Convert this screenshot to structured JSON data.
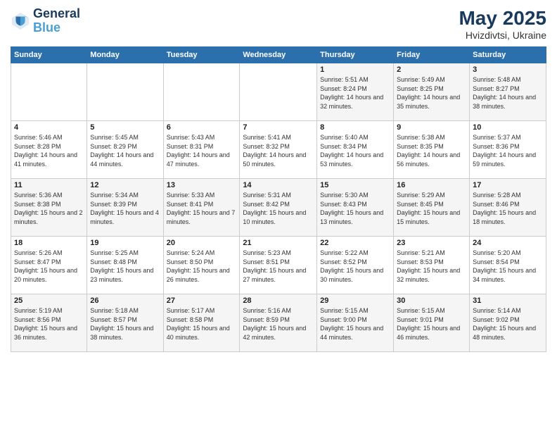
{
  "header": {
    "logo_line1": "General",
    "logo_line2": "Blue",
    "main_title": "May 2025",
    "subtitle": "Hvizdivtsi, Ukraine"
  },
  "calendar": {
    "days_of_week": [
      "Sunday",
      "Monday",
      "Tuesday",
      "Wednesday",
      "Thursday",
      "Friday",
      "Saturday"
    ],
    "weeks": [
      [
        {
          "day": "",
          "sunrise": "",
          "sunset": "",
          "daylight": ""
        },
        {
          "day": "",
          "sunrise": "",
          "sunset": "",
          "daylight": ""
        },
        {
          "day": "",
          "sunrise": "",
          "sunset": "",
          "daylight": ""
        },
        {
          "day": "",
          "sunrise": "",
          "sunset": "",
          "daylight": ""
        },
        {
          "day": "1",
          "sunrise": "Sunrise: 5:51 AM",
          "sunset": "Sunset: 8:24 PM",
          "daylight": "Daylight: 14 hours and 32 minutes."
        },
        {
          "day": "2",
          "sunrise": "Sunrise: 5:49 AM",
          "sunset": "Sunset: 8:25 PM",
          "daylight": "Daylight: 14 hours and 35 minutes."
        },
        {
          "day": "3",
          "sunrise": "Sunrise: 5:48 AM",
          "sunset": "Sunset: 8:27 PM",
          "daylight": "Daylight: 14 hours and 38 minutes."
        }
      ],
      [
        {
          "day": "4",
          "sunrise": "Sunrise: 5:46 AM",
          "sunset": "Sunset: 8:28 PM",
          "daylight": "Daylight: 14 hours and 41 minutes."
        },
        {
          "day": "5",
          "sunrise": "Sunrise: 5:45 AM",
          "sunset": "Sunset: 8:29 PM",
          "daylight": "Daylight: 14 hours and 44 minutes."
        },
        {
          "day": "6",
          "sunrise": "Sunrise: 5:43 AM",
          "sunset": "Sunset: 8:31 PM",
          "daylight": "Daylight: 14 hours and 47 minutes."
        },
        {
          "day": "7",
          "sunrise": "Sunrise: 5:41 AM",
          "sunset": "Sunset: 8:32 PM",
          "daylight": "Daylight: 14 hours and 50 minutes."
        },
        {
          "day": "8",
          "sunrise": "Sunrise: 5:40 AM",
          "sunset": "Sunset: 8:34 PM",
          "daylight": "Daylight: 14 hours and 53 minutes."
        },
        {
          "day": "9",
          "sunrise": "Sunrise: 5:38 AM",
          "sunset": "Sunset: 8:35 PM",
          "daylight": "Daylight: 14 hours and 56 minutes."
        },
        {
          "day": "10",
          "sunrise": "Sunrise: 5:37 AM",
          "sunset": "Sunset: 8:36 PM",
          "daylight": "Daylight: 14 hours and 59 minutes."
        }
      ],
      [
        {
          "day": "11",
          "sunrise": "Sunrise: 5:36 AM",
          "sunset": "Sunset: 8:38 PM",
          "daylight": "Daylight: 15 hours and 2 minutes."
        },
        {
          "day": "12",
          "sunrise": "Sunrise: 5:34 AM",
          "sunset": "Sunset: 8:39 PM",
          "daylight": "Daylight: 15 hours and 4 minutes."
        },
        {
          "day": "13",
          "sunrise": "Sunrise: 5:33 AM",
          "sunset": "Sunset: 8:41 PM",
          "daylight": "Daylight: 15 hours and 7 minutes."
        },
        {
          "day": "14",
          "sunrise": "Sunrise: 5:31 AM",
          "sunset": "Sunset: 8:42 PM",
          "daylight": "Daylight: 15 hours and 10 minutes."
        },
        {
          "day": "15",
          "sunrise": "Sunrise: 5:30 AM",
          "sunset": "Sunset: 8:43 PM",
          "daylight": "Daylight: 15 hours and 13 minutes."
        },
        {
          "day": "16",
          "sunrise": "Sunrise: 5:29 AM",
          "sunset": "Sunset: 8:45 PM",
          "daylight": "Daylight: 15 hours and 15 minutes."
        },
        {
          "day": "17",
          "sunrise": "Sunrise: 5:28 AM",
          "sunset": "Sunset: 8:46 PM",
          "daylight": "Daylight: 15 hours and 18 minutes."
        }
      ],
      [
        {
          "day": "18",
          "sunrise": "Sunrise: 5:26 AM",
          "sunset": "Sunset: 8:47 PM",
          "daylight": "Daylight: 15 hours and 20 minutes."
        },
        {
          "day": "19",
          "sunrise": "Sunrise: 5:25 AM",
          "sunset": "Sunset: 8:48 PM",
          "daylight": "Daylight: 15 hours and 23 minutes."
        },
        {
          "day": "20",
          "sunrise": "Sunrise: 5:24 AM",
          "sunset": "Sunset: 8:50 PM",
          "daylight": "Daylight: 15 hours and 26 minutes."
        },
        {
          "day": "21",
          "sunrise": "Sunrise: 5:23 AM",
          "sunset": "Sunset: 8:51 PM",
          "daylight": "Daylight: 15 hours and 27 minutes."
        },
        {
          "day": "22",
          "sunrise": "Sunrise: 5:22 AM",
          "sunset": "Sunset: 8:52 PM",
          "daylight": "Daylight: 15 hours and 30 minutes."
        },
        {
          "day": "23",
          "sunrise": "Sunrise: 5:21 AM",
          "sunset": "Sunset: 8:53 PM",
          "daylight": "Daylight: 15 hours and 32 minutes."
        },
        {
          "day": "24",
          "sunrise": "Sunrise: 5:20 AM",
          "sunset": "Sunset: 8:54 PM",
          "daylight": "Daylight: 15 hours and 34 minutes."
        }
      ],
      [
        {
          "day": "25",
          "sunrise": "Sunrise: 5:19 AM",
          "sunset": "Sunset: 8:56 PM",
          "daylight": "Daylight: 15 hours and 36 minutes."
        },
        {
          "day": "26",
          "sunrise": "Sunrise: 5:18 AM",
          "sunset": "Sunset: 8:57 PM",
          "daylight": "Daylight: 15 hours and 38 minutes."
        },
        {
          "day": "27",
          "sunrise": "Sunrise: 5:17 AM",
          "sunset": "Sunset: 8:58 PM",
          "daylight": "Daylight: 15 hours and 40 minutes."
        },
        {
          "day": "28",
          "sunrise": "Sunrise: 5:16 AM",
          "sunset": "Sunset: 8:59 PM",
          "daylight": "Daylight: 15 hours and 42 minutes."
        },
        {
          "day": "29",
          "sunrise": "Sunrise: 5:15 AM",
          "sunset": "Sunset: 9:00 PM",
          "daylight": "Daylight: 15 hours and 44 minutes."
        },
        {
          "day": "30",
          "sunrise": "Sunrise: 5:15 AM",
          "sunset": "Sunset: 9:01 PM",
          "daylight": "Daylight: 15 hours and 46 minutes."
        },
        {
          "day": "31",
          "sunrise": "Sunrise: 5:14 AM",
          "sunset": "Sunset: 9:02 PM",
          "daylight": "Daylight: 15 hours and 48 minutes."
        }
      ]
    ]
  }
}
